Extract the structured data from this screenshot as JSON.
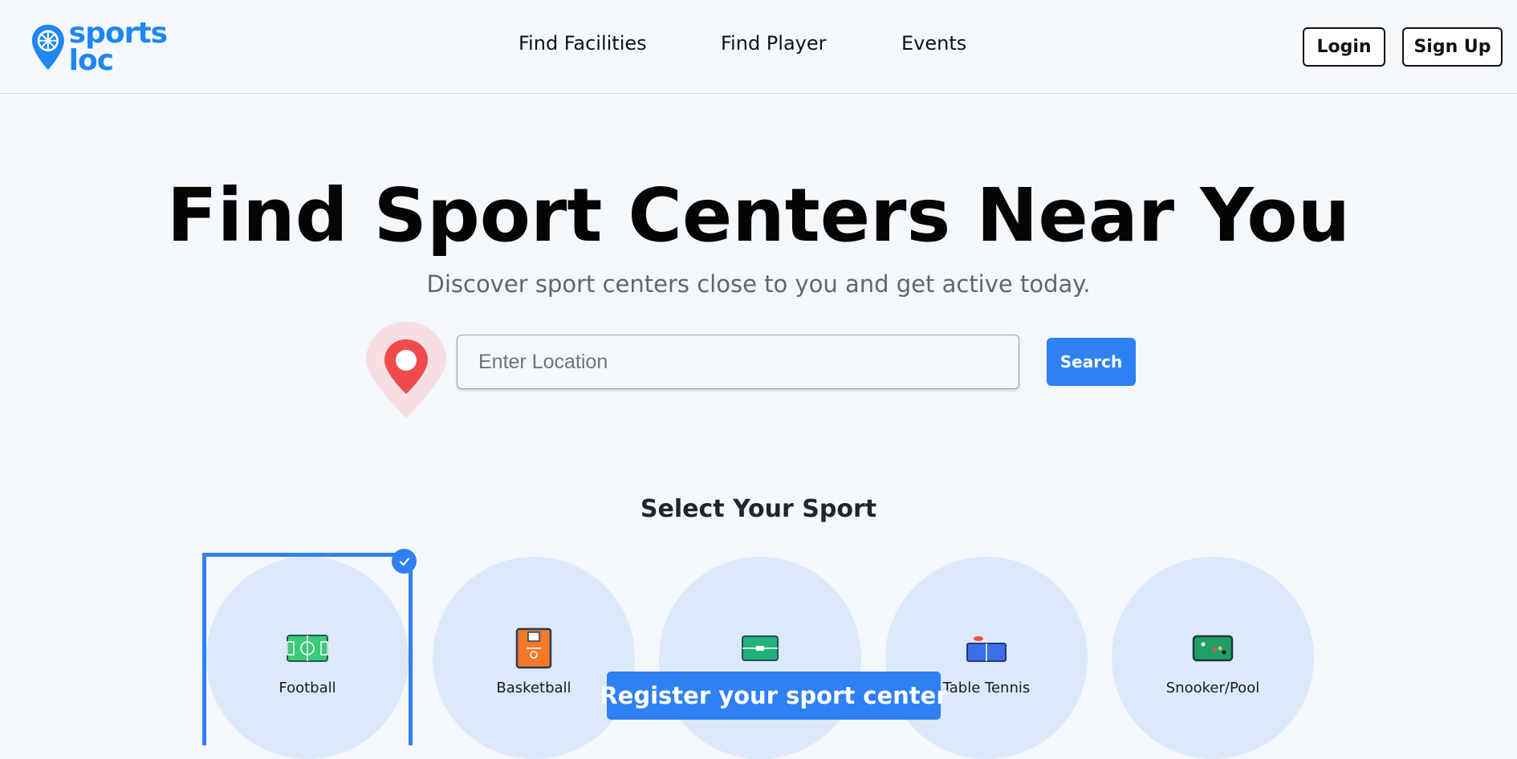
{
  "brand": {
    "line1": "sports",
    "line2": "loc",
    "color": "#1f86f2"
  },
  "nav": {
    "links": [
      "Find Facilities",
      "Find Player",
      "Events"
    ]
  },
  "auth": {
    "login": "Login",
    "signup": "Sign Up"
  },
  "hero": {
    "title": "Find Sport Centers Near You",
    "subtitle": "Discover sport centers close to you and get active today."
  },
  "search": {
    "placeholder": "Enter Location",
    "value": "",
    "button": "Search",
    "pin_icon": "location-pin-icon"
  },
  "sports": {
    "title": "Select Your Sport",
    "selected": "Football",
    "items": [
      {
        "label": "Football",
        "icon": "football-field-icon"
      },
      {
        "label": "Basketball",
        "icon": "basketball-court-icon"
      },
      {
        "label": "",
        "icon": "futsal-court-icon"
      },
      {
        "label": "Table Tennis",
        "icon": "table-tennis-icon"
      },
      {
        "label": "Snooker/Pool",
        "icon": "pool-table-icon"
      }
    ]
  },
  "cta": {
    "register": "Register your sport center"
  },
  "colors": {
    "accent": "#2f80f2",
    "background": "#f4f8fd",
    "card": "#dbe9fb",
    "pin": "#ef4b4f"
  }
}
